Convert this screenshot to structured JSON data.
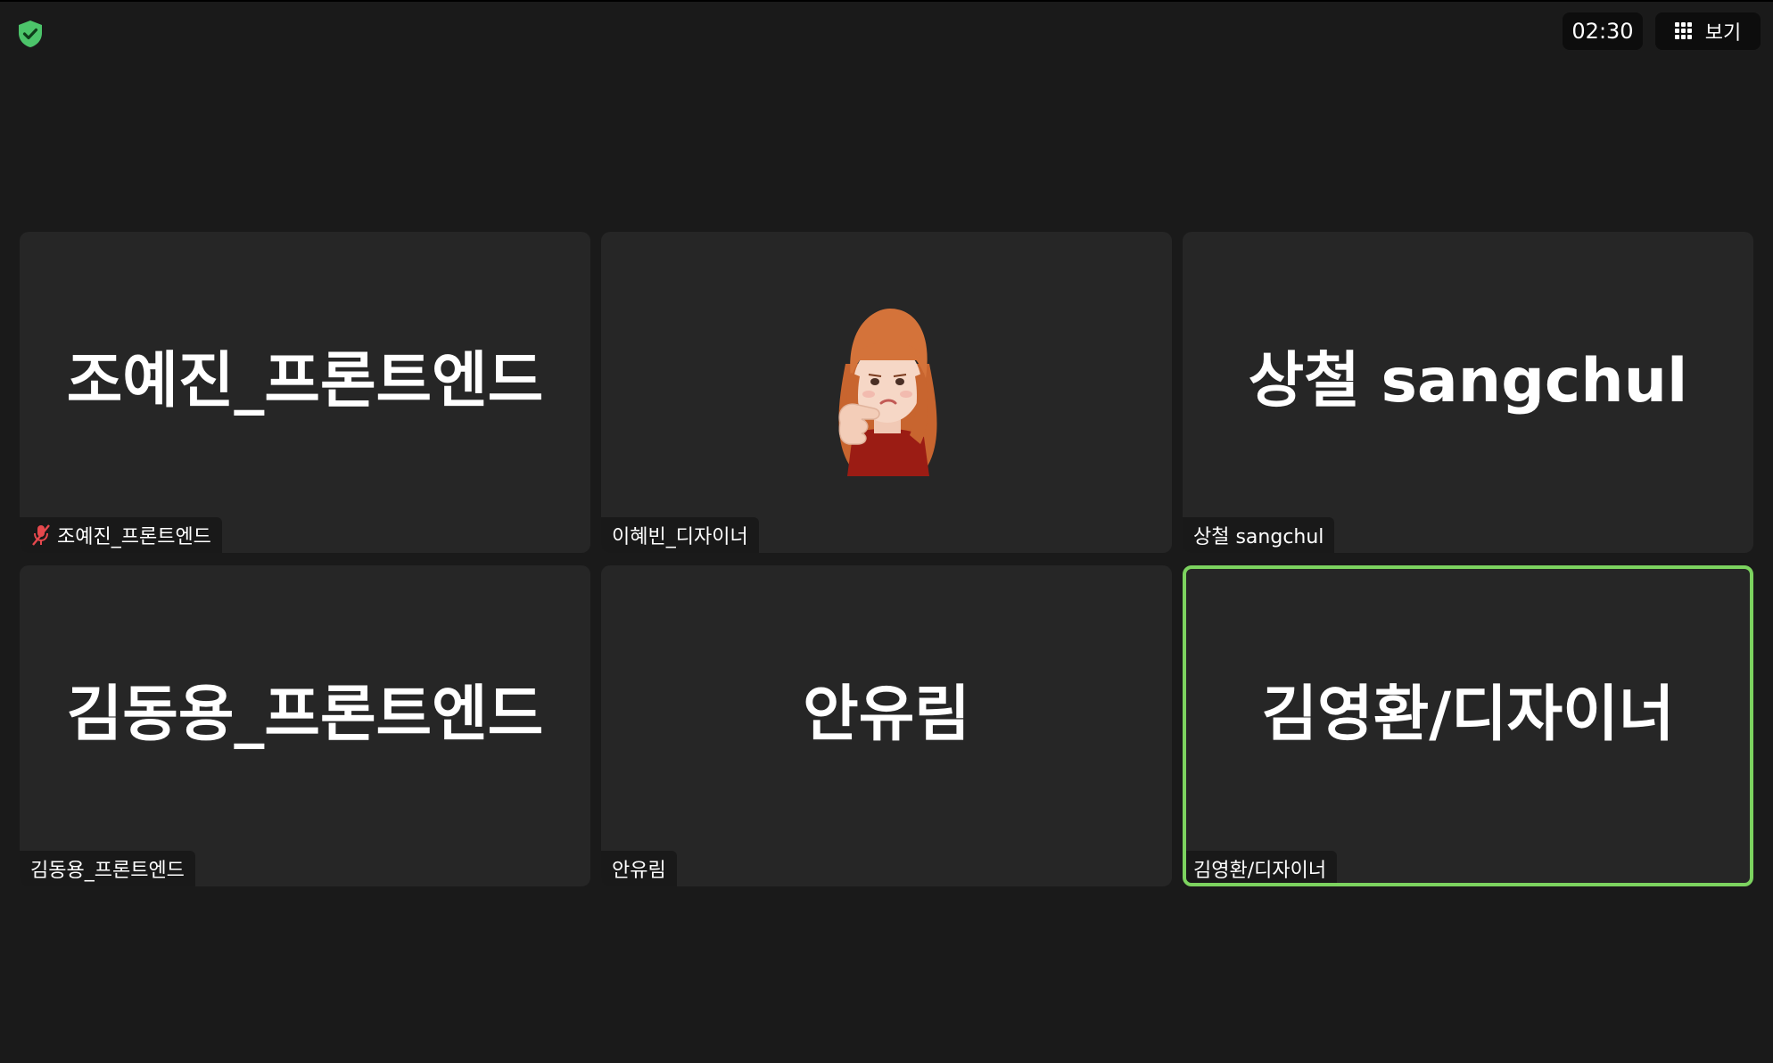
{
  "top_bar": {
    "shield_icon": "shield-check-icon",
    "timer": "02:30",
    "view_button_label": "보기",
    "view_button_icon": "grid-icon"
  },
  "tiles": [
    {
      "display_name": "조예진_프론트엔드",
      "label": "조예진_프론트엔드",
      "muted": true,
      "active": false
    },
    {
      "display_name": "",
      "label": "이혜빈_디자이너",
      "muted": false,
      "active": false,
      "avatar": "memoji-avatar"
    },
    {
      "display_name": "상철 sangchul",
      "label": "상철 sangchul",
      "muted": false,
      "active": false
    },
    {
      "display_name": "김동용_프론트엔드",
      "label": "김동용_프론트엔드",
      "muted": false,
      "active": false
    },
    {
      "display_name": "안유림",
      "label": "안유림",
      "muted": false,
      "active": false
    },
    {
      "display_name": "김영환/디자이너",
      "label": "김영환/디자이너",
      "muted": false,
      "active": true
    }
  ],
  "colors": {
    "background": "#1a1a1a",
    "tile": "#262626",
    "active_speaker_border": "#7cd35f",
    "mute_icon": "#e5484d",
    "shield": "#4cc46a"
  }
}
